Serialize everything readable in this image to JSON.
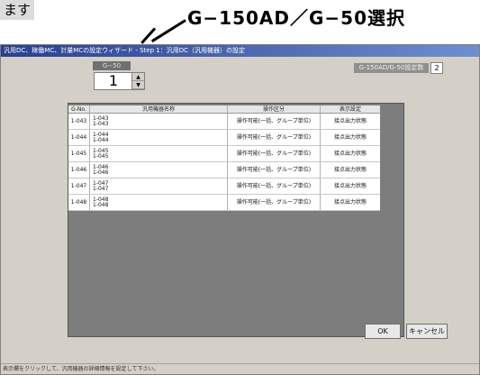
{
  "annotation": {
    "left_text": "ます",
    "callout": "G−150AD／G−50選択"
  },
  "window": {
    "title": "汎用DC、稼働MC、計量MCの設定ウィザード - Step 1：汎用DC（汎用機器）の設定",
    "g_label": "G−50",
    "spin_value": "1",
    "spin_up": "▲",
    "spin_down": "▼",
    "count_label": "G-150AD/G-50設定数",
    "count_value": "2"
  },
  "table": {
    "headers": [
      "G-No.",
      "汎用機器名称",
      "操作区分",
      "表示設定"
    ],
    "rows": [
      {
        "no": "1-043",
        "name1": "1-043",
        "name2": "1-043",
        "op": "操作可能(一括、グループ単位)",
        "disp": "接点出力状態"
      },
      {
        "no": "1-044",
        "name1": "1-044",
        "name2": "1-044",
        "op": "操作可能(一括、グループ単位)",
        "disp": "接点出力状態"
      },
      {
        "no": "1-045",
        "name1": "1-045",
        "name2": "1-045",
        "op": "操作可能(一括、グループ単位)",
        "disp": "接点出力状態"
      },
      {
        "no": "1-046",
        "name1": "1-046",
        "name2": "1-046",
        "op": "操作可能(一括、グループ単位)",
        "disp": "接点出力状態"
      },
      {
        "no": "1-047",
        "name1": "1-047",
        "name2": "1-047",
        "op": "操作可能(一括、グループ単位)",
        "disp": "接点出力状態"
      },
      {
        "no": "1-048",
        "name1": "1-048",
        "name2": "1-048",
        "op": "操作可能(一括、グループ単位)",
        "disp": "接点出力状態"
      }
    ]
  },
  "buttons": {
    "ok": "OK",
    "cancel": "キャンセル"
  },
  "status_bar": "表示欄をクリックして、汎用機器の詳細情報を設定して下さい。"
}
